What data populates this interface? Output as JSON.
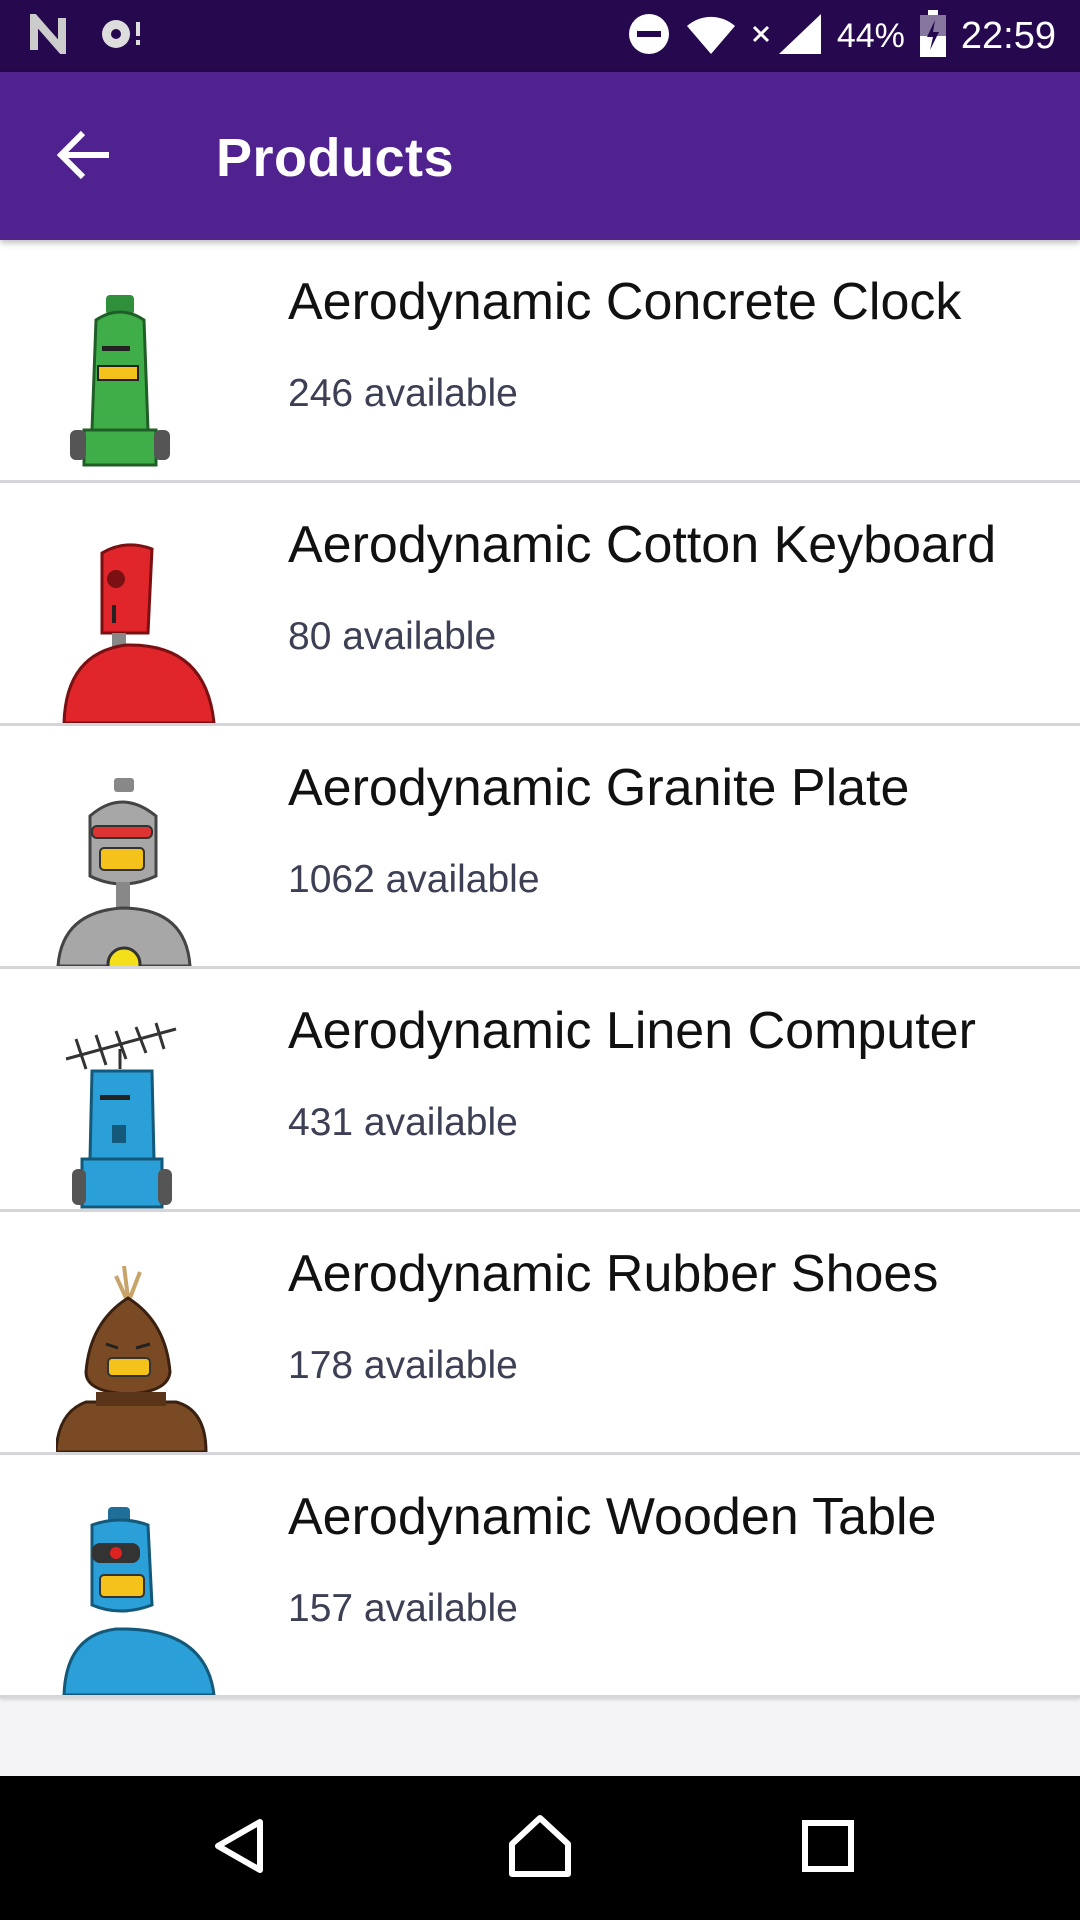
{
  "status_bar": {
    "time": "22:59",
    "battery_percent": "44%",
    "icons": [
      "notification-n-icon",
      "notification-app-icon",
      "do-not-disturb-icon",
      "wifi-icon",
      "no-data-icon",
      "cell-signal-icon",
      "battery-charging-icon"
    ]
  },
  "app_bar": {
    "title": "Products",
    "back_icon": "arrow-back-icon"
  },
  "products": [
    {
      "name": "Aerodynamic Concrete Clock",
      "stock": "246 available",
      "avatar_color": "#3fae49"
    },
    {
      "name": "Aerodynamic Cotton Keyboard",
      "stock": "80 available",
      "avatar_color": "#e0262b"
    },
    {
      "name": "Aerodynamic Granite Plate",
      "stock": "1062 available",
      "avatar_color": "#9c9c9c"
    },
    {
      "name": "Aerodynamic Linen Computer",
      "stock": "431 available",
      "avatar_color": "#2a9fd8"
    },
    {
      "name": "Aerodynamic Rubber Shoes",
      "stock": "178 available",
      "avatar_color": "#7a4a25"
    },
    {
      "name": "Aerodynamic Wooden Table",
      "stock": "157 available",
      "avatar_color": "#2a9fd8"
    }
  ],
  "nav_bar": {
    "icons": [
      "back-triangle-icon",
      "home-icon",
      "recents-icon"
    ]
  },
  "colors": {
    "status_bar": "#26084f",
    "app_bar": "#4f228f",
    "background": "#f4f4f6"
  }
}
